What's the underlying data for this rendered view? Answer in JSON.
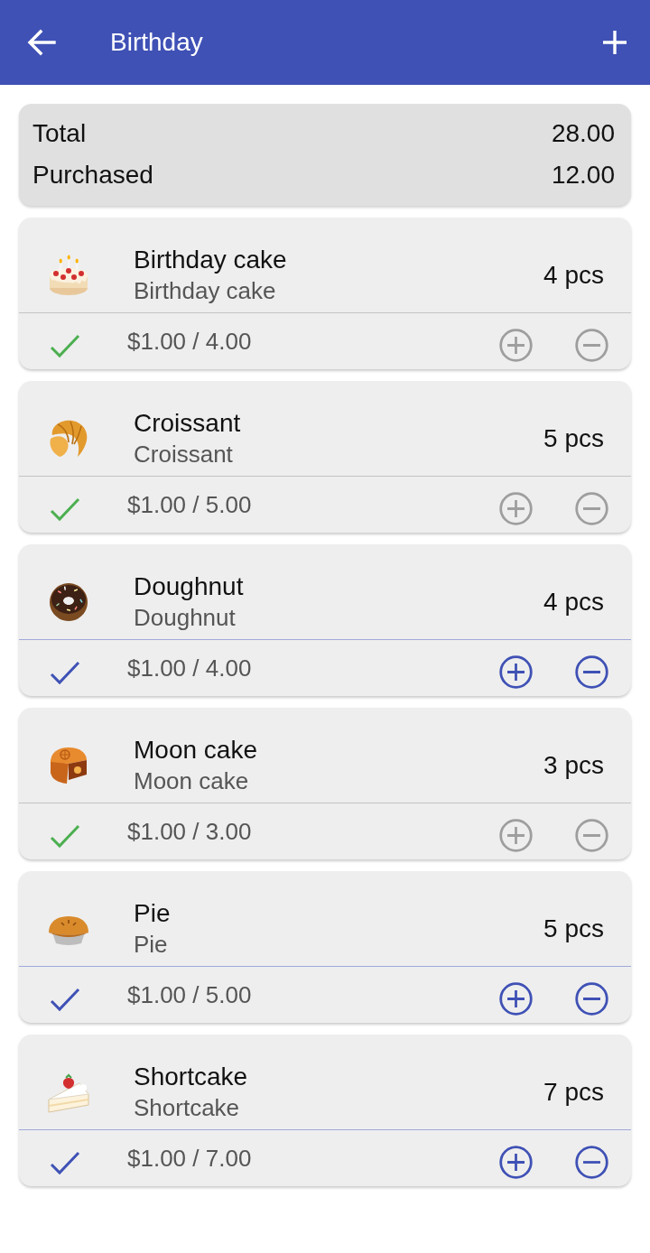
{
  "app_bar": {
    "title": "Birthday"
  },
  "summary": {
    "rows": [
      {
        "label": "Total",
        "value": "28.00"
      },
      {
        "label": "Purchased",
        "value": "12.00"
      }
    ]
  },
  "items": [
    {
      "kind": "cake",
      "name": "Birthday cake",
      "subtitle": "Birthday cake",
      "quantity": "4 pcs",
      "purchased": true,
      "price": "$1.00 / 4.00"
    },
    {
      "kind": "croissant",
      "name": "Croissant",
      "subtitle": "Croissant",
      "quantity": "5 pcs",
      "purchased": true,
      "price": "$1.00 / 5.00"
    },
    {
      "kind": "doughnut",
      "name": "Doughnut",
      "subtitle": "Doughnut",
      "quantity": "4 pcs",
      "purchased": false,
      "price": "$1.00 / 4.00"
    },
    {
      "kind": "mooncake",
      "name": "Moon cake",
      "subtitle": "Moon cake",
      "quantity": "3 pcs",
      "purchased": true,
      "price": "$1.00 / 3.00"
    },
    {
      "kind": "pie",
      "name": "Pie",
      "subtitle": "Pie",
      "quantity": "5 pcs",
      "purchased": false,
      "price": "$1.00 / 5.00"
    },
    {
      "kind": "shortcake",
      "name": "Shortcake",
      "subtitle": "Shortcake",
      "quantity": "7 pcs",
      "purchased": false,
      "price": "$1.00 / 7.00"
    }
  ]
}
